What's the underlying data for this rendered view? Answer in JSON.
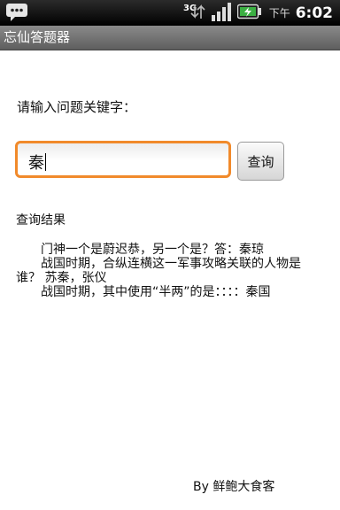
{
  "status_bar": {
    "network_type": "3G",
    "ampm": "下午",
    "time": "6:02",
    "icons": [
      "notification-icon",
      "network-3g-icon",
      "signal-icon",
      "battery-charging-icon"
    ]
  },
  "app": {
    "title": "忘仙答题器"
  },
  "search": {
    "prompt": "请输入问题关键字：",
    "value": "秦",
    "button_label": "查询"
  },
  "results": {
    "heading": "查询结果",
    "items": [
      "门神一个是蔚迟恭，另一个是？答：秦琼",
      "战国时期，合纵连横这一军事攻略关联的人物是谁？ 苏秦，张仪",
      "战国时期，其中使用“半两”的是：：：：秦国"
    ]
  },
  "footer": {
    "credit": "By 鲜鲍大食客"
  },
  "colors": {
    "input_focus": "#f18a2b",
    "title_bar": "#6f6f6f"
  }
}
